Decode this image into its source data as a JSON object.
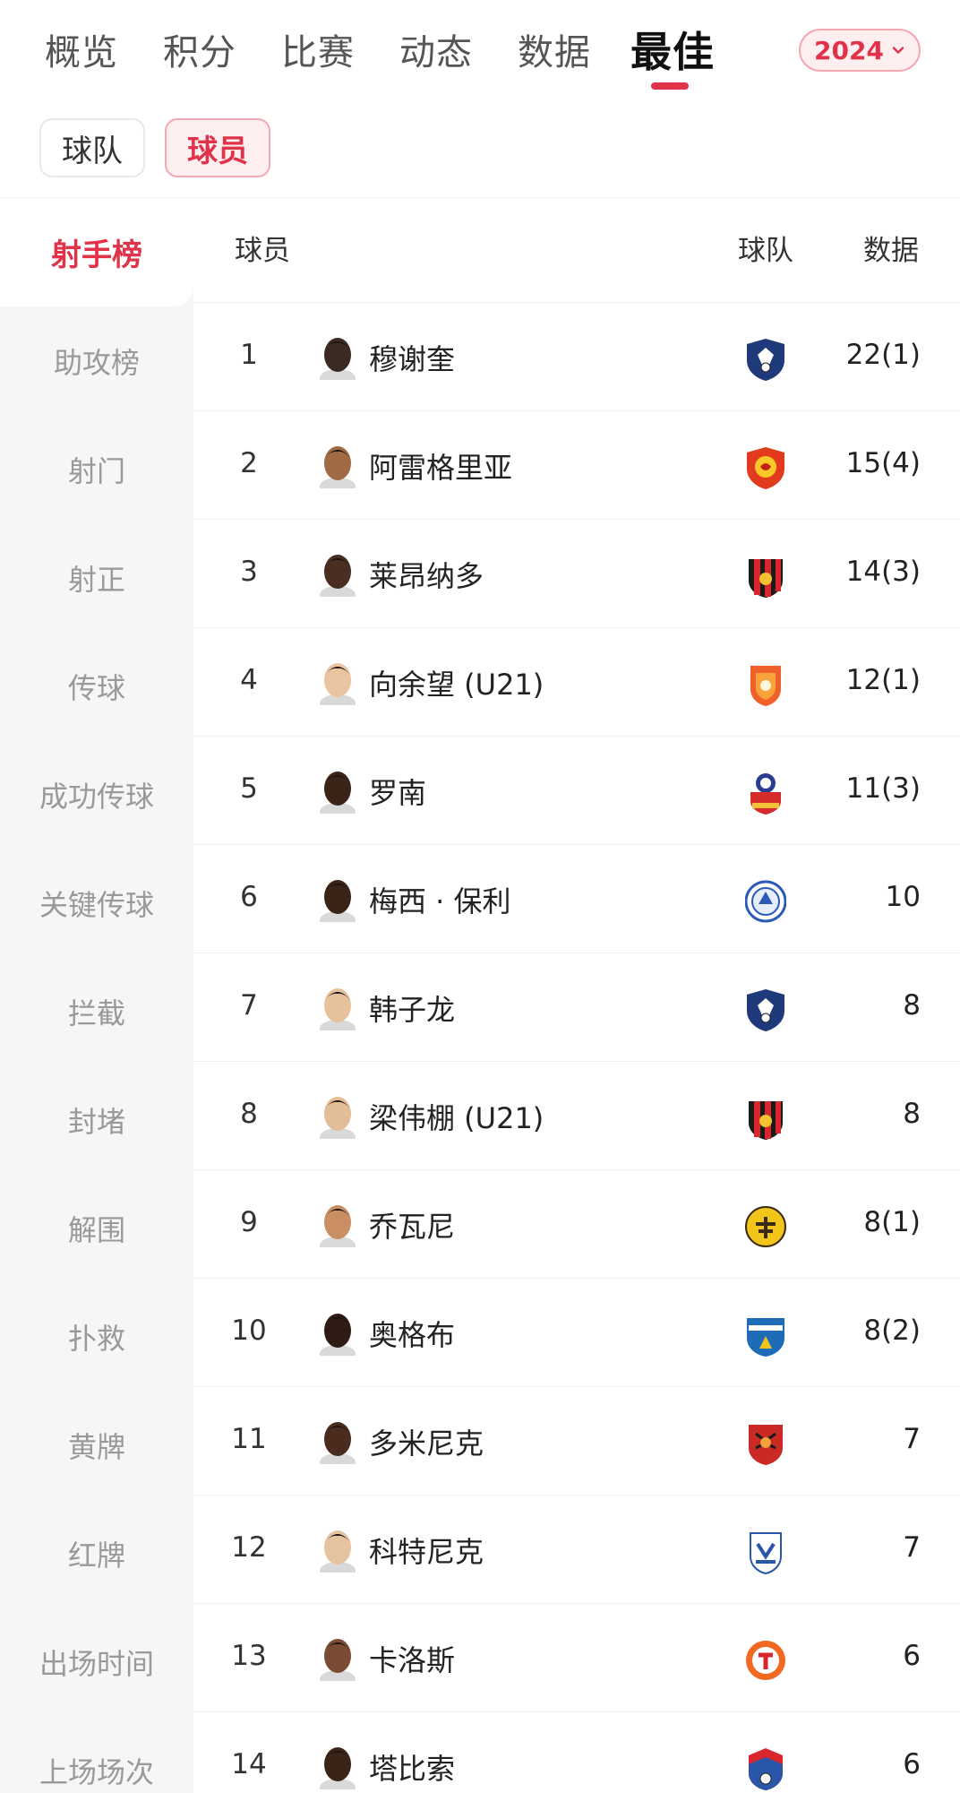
{
  "nav": {
    "tabs": [
      "概览",
      "积分",
      "比赛",
      "动态",
      "数据",
      "最佳"
    ],
    "active_tab": "最佳",
    "year": "2024",
    "accent": "#e0334a"
  },
  "segments": {
    "team": "球队",
    "player": "球员",
    "active": "球员"
  },
  "sidebar": {
    "items": [
      "射手榜",
      "助攻榜",
      "射门",
      "射正",
      "传球",
      "成功传球",
      "关键传球",
      "拦截",
      "封堵",
      "解围",
      "扑救",
      "黄牌",
      "红牌",
      "出场时间",
      "上场场次"
    ],
    "active": "射手榜"
  },
  "table": {
    "headers": {
      "player": "球员",
      "team": "球队",
      "data": "数据"
    },
    "rows": [
      {
        "rank": "1",
        "name": "穆谢奎",
        "stat": "22(1)",
        "badge": "shield-navy-icon",
        "skin": "#3a2a22"
      },
      {
        "rank": "2",
        "name": "阿雷格里亚",
        "stat": "15(4)",
        "badge": "lion-red-icon",
        "skin": "#a06a45"
      },
      {
        "rank": "3",
        "name": "莱昂纳多",
        "stat": "14(3)",
        "badge": "striped-red-black-icon",
        "skin": "#4a2e22"
      },
      {
        "rank": "4",
        "name": "向余望 (U21)",
        "stat": "12(1)",
        "badge": "shield-orange-icon",
        "skin": "#e8c4a0"
      },
      {
        "rank": "5",
        "name": "罗南",
        "stat": "11(3)",
        "badge": "shield-blue-red-icon",
        "skin": "#3a2418"
      },
      {
        "rank": "6",
        "name": "梅西 · 保利",
        "stat": "10",
        "badge": "round-blue-icon",
        "skin": "#3a2418"
      },
      {
        "rank": "7",
        "name": "韩子龙",
        "stat": "8",
        "badge": "shield-navy-icon",
        "skin": "#e6c19c"
      },
      {
        "rank": "8",
        "name": "梁伟棚 (U21)",
        "stat": "8",
        "badge": "striped-red-black-icon",
        "skin": "#e2bd98"
      },
      {
        "rank": "9",
        "name": "乔瓦尼",
        "stat": "8(1)",
        "badge": "round-yellow-icon",
        "skin": "#c98e63"
      },
      {
        "rank": "10",
        "name": "奥格布",
        "stat": "8(2)",
        "badge": "shield-blue-white-icon",
        "skin": "#2e1c14"
      },
      {
        "rank": "11",
        "name": "多米尼克",
        "stat": "7",
        "badge": "shield-red-tiger-icon",
        "skin": "#4a2c1e"
      },
      {
        "rank": "12",
        "name": "科特尼克",
        "stat": "7",
        "badge": "shield-white-blue-icon",
        "skin": "#e5c2a0"
      },
      {
        "rank": "13",
        "name": "卡洛斯",
        "stat": "6",
        "badge": "round-orange-icon",
        "skin": "#7a4c34"
      },
      {
        "rank": "14",
        "name": "塔比索",
        "stat": "6",
        "badge": "shield-red-blue-icon",
        "skin": "#3a2418"
      }
    ]
  }
}
